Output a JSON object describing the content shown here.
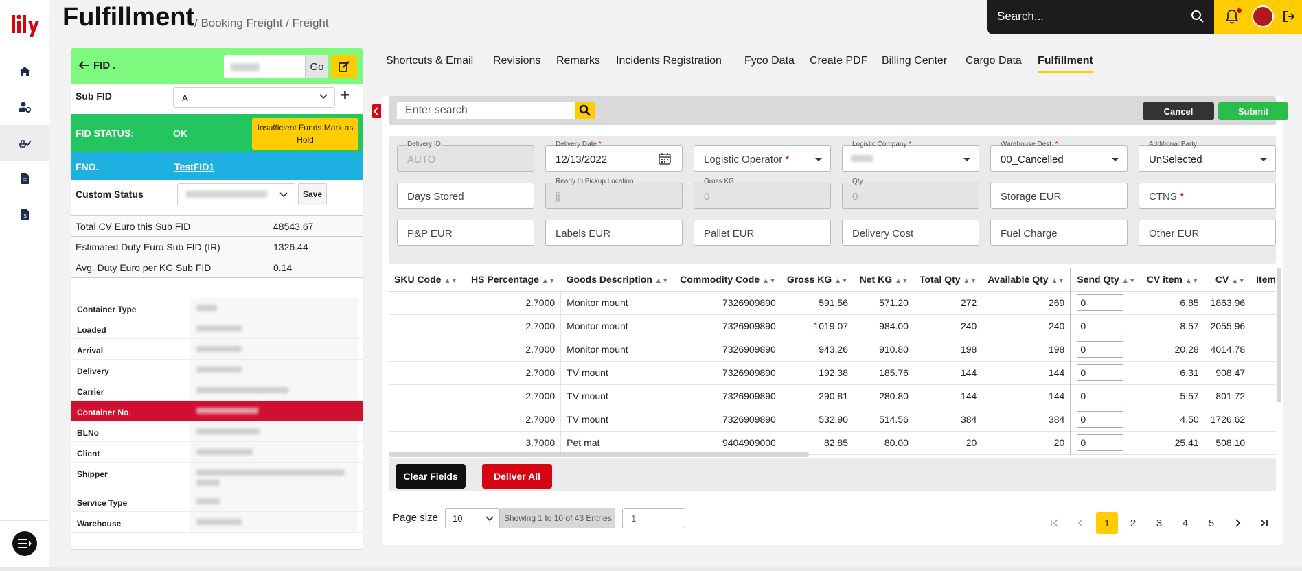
{
  "header": {
    "title": "Fulfillment",
    "breadcrumb": "/ Booking Freight / Freight"
  },
  "search": {
    "placeholder": "Search..."
  },
  "fid": {
    "label": "FID .",
    "go_label": "Go",
    "subfid_label": "Sub FID",
    "subfid_value": "A",
    "subfid_add": "+",
    "status_label": "FID STATUS:",
    "status_value": "OK",
    "insufficient_button": "Insufficient Funds Mark as Hold",
    "fno_label": "FNO.",
    "fno_value": "TestFID1",
    "custom_status_label": "Custom Status",
    "save_label": "Save"
  },
  "totals": [
    {
      "label": "Total CV Euro this Sub FID",
      "value": "48543.67"
    },
    {
      "label": "Estimated Duty Euro Sub FID (IR)",
      "value": "1326.44"
    },
    {
      "label": "Avg. Duty Euro per KG Sub FID",
      "value": "0.14"
    }
  ],
  "container_info": [
    {
      "label": "Container Type"
    },
    {
      "label": "Loaded"
    },
    {
      "label": "Arrival"
    },
    {
      "label": "Delivery"
    },
    {
      "label": "Carrier"
    },
    {
      "label": "Container No."
    },
    {
      "label": "BLNo"
    },
    {
      "label": "Client"
    },
    {
      "label": "Shipper"
    },
    {
      "label": "Service Type"
    },
    {
      "label": "Warehouse"
    }
  ],
  "tabs": [
    "Shortcuts & Email",
    "Revisions",
    "Remarks",
    "Incidents Registration",
    "Fyco Data",
    "Create PDF",
    "Billing Center",
    "Cargo Data",
    "Fulfillment"
  ],
  "toolbar": {
    "search_placeholder": "Enter search",
    "cancel_label": "Cancel",
    "submit_label": "Submit"
  },
  "form": {
    "delivery_id": {
      "label": "Delivery ID",
      "value": "AUTO"
    },
    "delivery_date": {
      "label": "Delivery Date",
      "value": "12/13/2022"
    },
    "logistic_operator": {
      "placeholder": "Logistic Operator"
    },
    "logistic_company": {
      "label": "Logistic Company"
    },
    "warehouse_dest": {
      "label": "Warehouse Dest.",
      "value": "00_Cancelled"
    },
    "additional_party": {
      "label": "Additional Party",
      "value": "UnSelected"
    },
    "days_stored": {
      "placeholder": "Days Stored"
    },
    "ready_pickup": {
      "label": "Ready to Pickup Location",
      "value": "jj"
    },
    "gross_kg": {
      "label": "Gross KG",
      "value": "0"
    },
    "qty": {
      "label": "Qty",
      "value": "0"
    },
    "storage_eur": {
      "placeholder": "Storage EUR"
    },
    "ctns": {
      "placeholder": "CTNS"
    },
    "pp_eur": {
      "placeholder": "P&P EUR"
    },
    "labels_eur": {
      "placeholder": "Labels EUR"
    },
    "pallet_eur": {
      "placeholder": "Pallet EUR"
    },
    "delivery_cost": {
      "placeholder": "Delivery Cost"
    },
    "fuel_charge": {
      "placeholder": "Fuel Charge"
    },
    "other_eur": {
      "placeholder": "Other EUR"
    }
  },
  "table": {
    "columns": [
      "SKU Code",
      "HS Percentage",
      "Goods Description",
      "Commodity Code",
      "Gross KG",
      "Net KG",
      "Total Qty",
      "Available Qty",
      "Send Qty",
      "CV item",
      "CV",
      "Item"
    ],
    "rows": [
      [
        "",
        "2.7000",
        "Monitor mount",
        "7326909890",
        "591.56",
        "571.20",
        "272",
        "269",
        "0",
        "6.85",
        "1863.96"
      ],
      [
        "",
        "2.7000",
        "Monitor mount",
        "7326909890",
        "1019.07",
        "984.00",
        "240",
        "240",
        "0",
        "8.57",
        "2055.96"
      ],
      [
        "",
        "2.7000",
        "Monitor mount",
        "7326909890",
        "943.26",
        "910.80",
        "198",
        "198",
        "0",
        "20.28",
        "4014.78"
      ],
      [
        "",
        "2.7000",
        "TV mount",
        "7326909890",
        "192.38",
        "185.76",
        "144",
        "144",
        "0",
        "6.31",
        "908.47"
      ],
      [
        "",
        "2.7000",
        "TV mount",
        "7326909890",
        "290.81",
        "280.80",
        "144",
        "144",
        "0",
        "5.57",
        "801.72"
      ],
      [
        "",
        "2.7000",
        "TV mount",
        "7326909890",
        "532.90",
        "514.56",
        "384",
        "384",
        "0",
        "4.50",
        "1726.62"
      ],
      [
        "",
        "3.7000",
        "Pet mat",
        "9404909000",
        "82.85",
        "80.00",
        "20",
        "20",
        "0",
        "25.41",
        "508.10"
      ]
    ]
  },
  "actions": {
    "clear_label": "Clear Fields",
    "deliver_label": "Deliver All"
  },
  "pagination": {
    "page_size_label": "Page size",
    "page_size": "10",
    "info": "Showing 1 to 10 of 43 Entries",
    "page_input": "1",
    "pages": [
      "1",
      "2",
      "3",
      "4",
      "5"
    ],
    "current": "1"
  },
  "colors": {
    "brand_red": "#d40511",
    "brand_yellow": "#ffcc00",
    "status_green": "#22c55e",
    "fno_blue": "#1db0e0",
    "fid_green": "#7dfa7d"
  }
}
